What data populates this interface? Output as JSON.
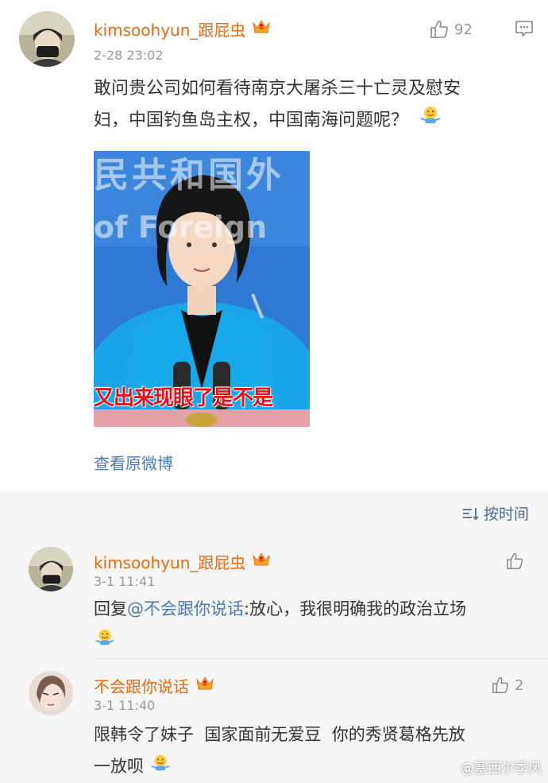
{
  "post": {
    "username": "kimsoohyun_跟屁虫",
    "time": "2-28 23:02",
    "likes": "92",
    "text_line1": "敢问贵公司如何看待南京大屠杀三十亡灵及慰安",
    "text_line2": "妇，中国钓鱼岛主权，中国南海问题呢？",
    "image_caption": "又出来现眼了是不是",
    "image_bg_text1": "民共和国外",
    "image_bg_text2": "of Foreign",
    "view_original": "查看原微博"
  },
  "comments_section": {
    "sort_label": "按时间",
    "comments": [
      {
        "username": "kimsoohyun_跟屁虫",
        "time": "3-1 11:41",
        "reply_prefix": "回复",
        "mention": "@不会跟你说话",
        "text": ":放心，我很明确我的政治立场",
        "likes": ""
      },
      {
        "username": "不会跟你说话",
        "time": "3-1 11:40",
        "text_line1": "限韩令了妹子  国家面前无爱豆  你的秀贤葛格先放",
        "text_line2": "一放呗",
        "likes": "2"
      }
    ]
  },
  "watermark": "@塞西尔季风",
  "colors": {
    "username": "#e86b0c",
    "link": "#4a7bb7",
    "meta": "#999999",
    "comments_bg": "#f5f5f5"
  }
}
